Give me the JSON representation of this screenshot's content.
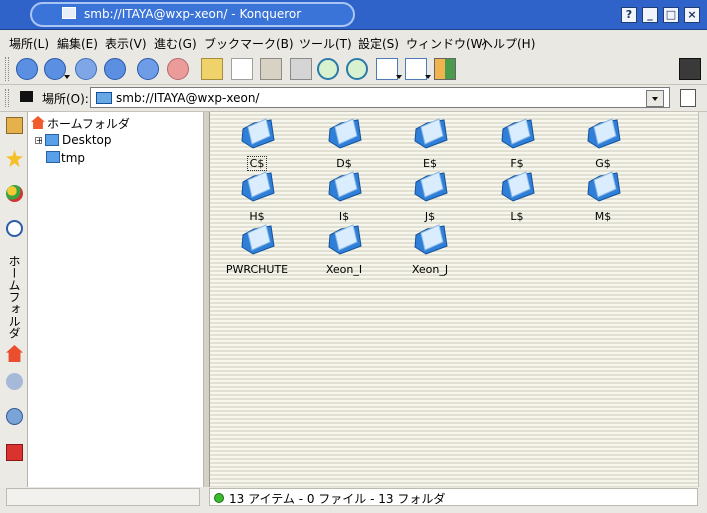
{
  "window": {
    "title": "smb://ITAYA@wxp-xeon/ - Konqueror",
    "buttons": [
      "?",
      "_",
      "□",
      "×"
    ]
  },
  "menu": [
    "場所(L)",
    "編集(E)",
    "表示(V)",
    "進む(G)",
    "ブックマーク(B)",
    "ツール(T)",
    "設定(S)",
    "ウィンドウ(W)",
    "ヘルプ(H)"
  ],
  "location": {
    "label": "場所(O):",
    "url": "smb://ITAYA@wxp-xeon/"
  },
  "sidebar": {
    "vertical_label": "ホームフォルダ",
    "tree": {
      "root": "ホームフォルダ",
      "items": [
        "Desktop",
        "tmp"
      ]
    }
  },
  "folders": [
    {
      "name": "C$",
      "selected": true
    },
    {
      "name": "D$",
      "selected": false
    },
    {
      "name": "E$",
      "selected": false
    },
    {
      "name": "F$",
      "selected": false
    },
    {
      "name": "G$",
      "selected": false
    },
    {
      "name": "H$",
      "selected": false
    },
    {
      "name": "I$",
      "selected": false
    },
    {
      "name": "J$",
      "selected": false
    },
    {
      "name": "L$",
      "selected": false
    },
    {
      "name": "M$",
      "selected": false
    },
    {
      "name": "PWRCHUTE",
      "selected": false
    },
    {
      "name": "Xeon_I",
      "selected": false
    },
    {
      "name": "Xeon_J",
      "selected": false
    }
  ],
  "status": {
    "text": "13 アイテム - 0 ファイル - 13 フォルダ"
  },
  "colors": {
    "title_bar": "#2f63c9",
    "folder_blue": "#3e8de3",
    "status_green": "#3bbb2f"
  }
}
